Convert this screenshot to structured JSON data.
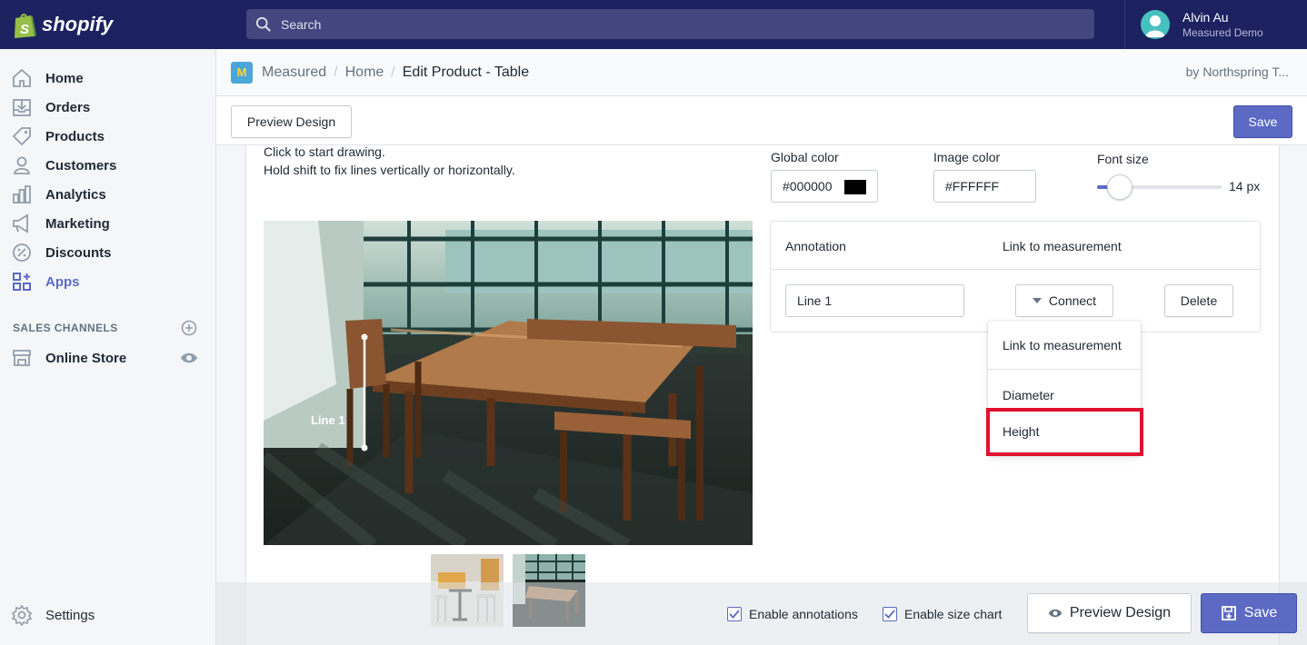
{
  "topbar": {
    "logo_text": "shopify",
    "search_placeholder": "Search",
    "user_name": "Alvin Au",
    "user_shop": "Measured Demo"
  },
  "sidebar": {
    "items": [
      {
        "label": "Home",
        "icon": "home-icon"
      },
      {
        "label": "Orders",
        "icon": "orders-icon"
      },
      {
        "label": "Products",
        "icon": "tag-icon"
      },
      {
        "label": "Customers",
        "icon": "person-icon"
      },
      {
        "label": "Analytics",
        "icon": "bar-chart-icon"
      },
      {
        "label": "Marketing",
        "icon": "megaphone-icon"
      },
      {
        "label": "Discounts",
        "icon": "discount-icon"
      },
      {
        "label": "Apps",
        "icon": "apps-icon"
      }
    ],
    "sales_channels_title": "SALES CHANNELS",
    "online_store": "Online Store",
    "settings": "Settings",
    "active_color": "#5c6ac4"
  },
  "breadcrumb": {
    "app_logo": "M",
    "app_name": "Measured",
    "sep1": "/",
    "home": "Home",
    "sep2": "/",
    "current": "Edit Product - Table",
    "byline": "by Northspring T..."
  },
  "actions": {
    "preview_label": "Preview Design",
    "save_label": "Save"
  },
  "editor": {
    "instruction_1": "Click to start drawing.",
    "instruction_2": "Hold shift to fix lines vertically or horizontally.",
    "global_color_label": "Global color",
    "global_color_value": "#000000",
    "image_color_label": "Image color",
    "image_color_value": "#FFFFFF",
    "font_size_label": "Font size",
    "font_size_value": "14 px",
    "font_size_fraction": 0.18,
    "line_label": "Line 1"
  },
  "annotations": {
    "col_annotation": "Annotation",
    "col_link": "Link to measurement",
    "row_name": "Line 1",
    "connect_label": "Connect",
    "delete_label": "Delete"
  },
  "dropdown": {
    "header": "Link to measurement",
    "options": [
      "Diameter",
      "Height"
    ],
    "highlight_color": "#e0102e"
  },
  "footer": {
    "enable_annotations": "Enable annotations",
    "enable_size_chart": "Enable size chart",
    "preview_label": "Preview Design",
    "save_label": "Save"
  }
}
